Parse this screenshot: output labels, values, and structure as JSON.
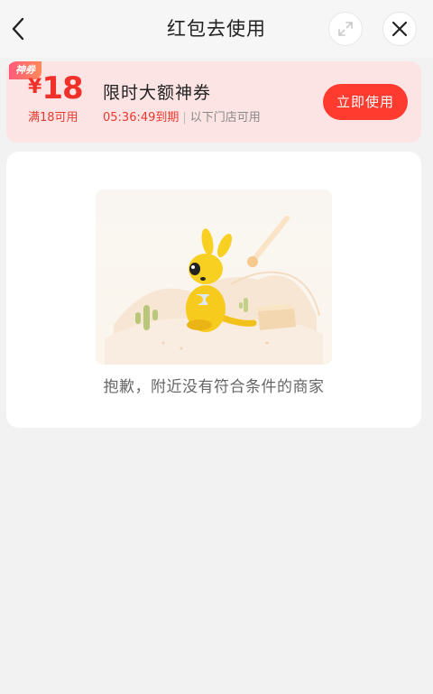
{
  "header": {
    "title": "红包去使用",
    "back_icon": "chevron-left-icon",
    "expand_icon": "expand-icon",
    "close_icon": "close-icon"
  },
  "coupon": {
    "tag": "神券",
    "currency": "¥",
    "amount": "18",
    "threshold": "满18可用",
    "name": "限时大额神券",
    "countdown": "05:36:49到期",
    "separator": "|",
    "scope": "以下门店可用",
    "button_label": "立即使用",
    "accent_color": "#ff3b2f",
    "background_color": "#fde4e4"
  },
  "empty_state": {
    "illustration": "kangaroo-desert-illustration",
    "message": "抱歉，附近没有符合条件的商家"
  }
}
